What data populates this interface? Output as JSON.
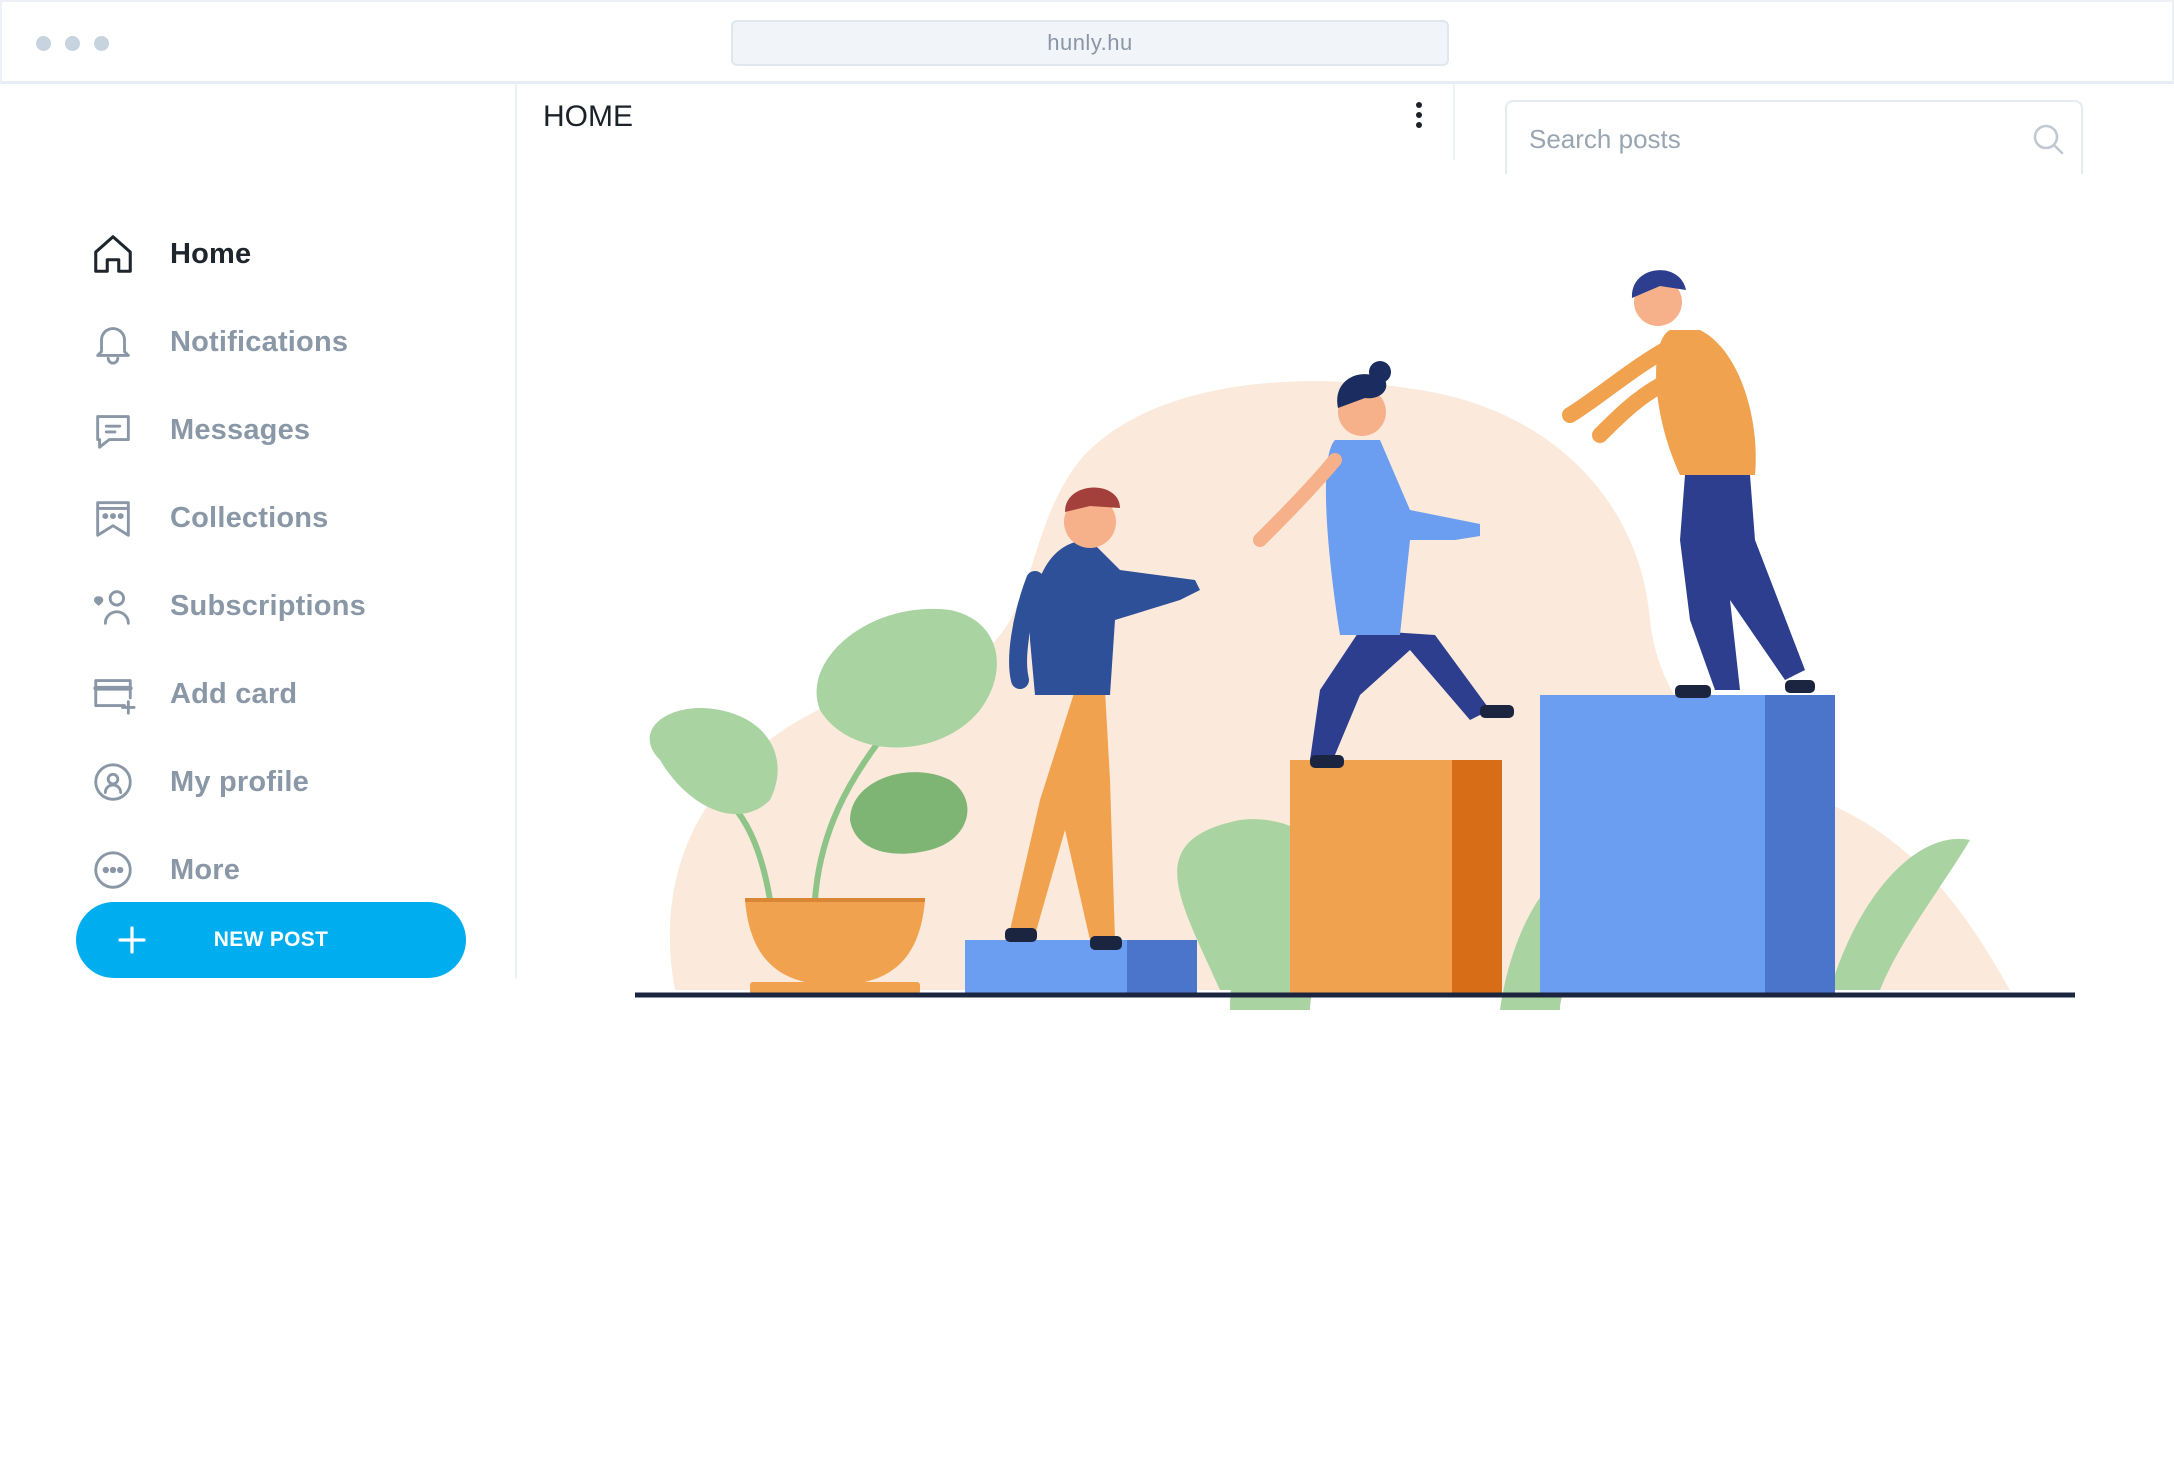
{
  "browser": {
    "url": "hunly.hu"
  },
  "sidebar": {
    "items": [
      {
        "label": "Home",
        "icon": "home-icon",
        "active": true
      },
      {
        "label": "Notifications",
        "icon": "bell-icon",
        "active": false
      },
      {
        "label": "Messages",
        "icon": "message-icon",
        "active": false
      },
      {
        "label": "Collections",
        "icon": "collections-icon",
        "active": false
      },
      {
        "label": "Subscriptions",
        "icon": "subscriptions-icon",
        "active": false
      },
      {
        "label": "Add card",
        "icon": "credit-card-icon",
        "active": false
      },
      {
        "label": "My profile",
        "icon": "profile-icon",
        "active": false
      },
      {
        "label": "More",
        "icon": "more-icon",
        "active": false
      }
    ],
    "new_post_label": "NEW POST"
  },
  "header": {
    "title": "HOME"
  },
  "search": {
    "placeholder": "Search posts"
  },
  "colors": {
    "accent": "#00aeef",
    "text_active": "#1e252d",
    "text_muted": "#8a97a6"
  }
}
